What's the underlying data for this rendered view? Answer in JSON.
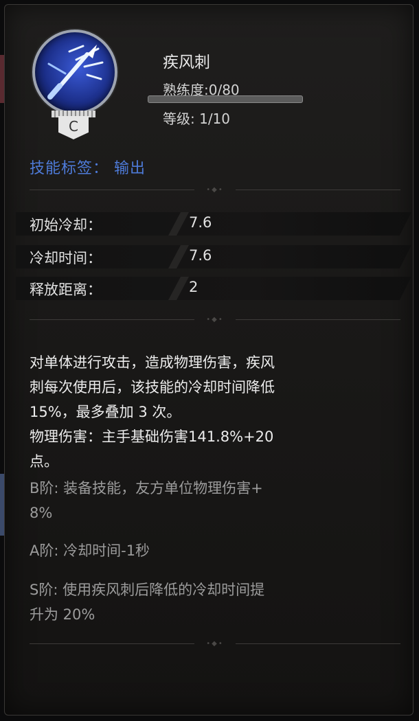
{
  "skill": {
    "name": "疾风刺",
    "proficiency_label": "熟练度:0/80",
    "proficiency_fraction": 0.0,
    "level_label": "等级: 1/10",
    "grade": "C",
    "icon": "wind-thrust-skill-icon"
  },
  "tags": {
    "line": "技能标签：  输出"
  },
  "stats": [
    {
      "label": "初始冷却：",
      "value": "7.6"
    },
    {
      "label": "冷却时间：",
      "value": "7.6"
    },
    {
      "label": "释放距离：",
      "value": "2"
    }
  ],
  "description": {
    "lines": [
      "对单体进行攻击，造成物理伤害，疾风",
      "刺每次使用后，该技能的冷却时间降低",
      "15%，最多叠加 3 次。",
      "物理伤害：主手基础伤害141.8%+20",
      "点。"
    ]
  },
  "tiers": {
    "b": [
      "B阶: 装备技能，友方单位物理伤害+",
      "8%"
    ],
    "a": [
      "A阶: 冷却时间-1秒"
    ],
    "s": [
      "S阶: 使用疾风刺后降低的冷却时间提",
      "升为 20%"
    ]
  },
  "colors": {
    "tag_blue": "#4e7bd9",
    "icon_blue": "#3a5ad6",
    "tier_gray": "#9c9c9c"
  }
}
